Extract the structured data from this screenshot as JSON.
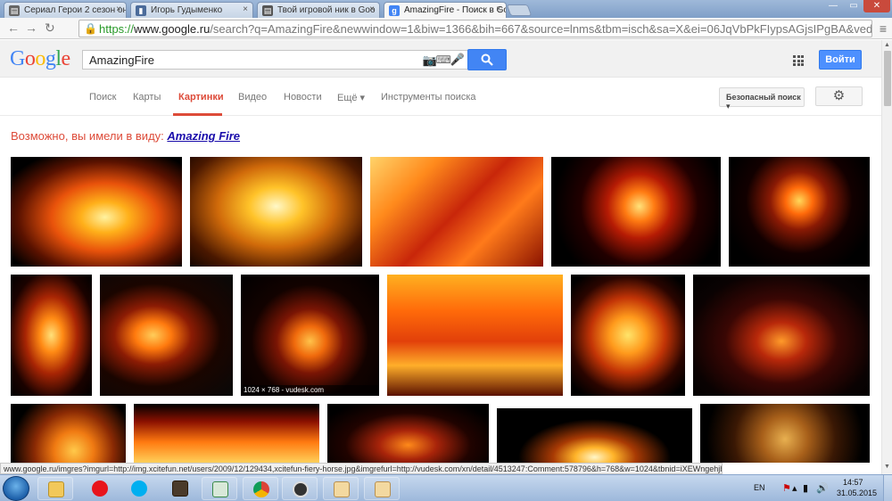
{
  "browser": {
    "tabs": [
      {
        "title": "Сериал Герои 2 сезон он",
        "favicon_color": "#666666",
        "active": false
      },
      {
        "title": "Игорь Гудыменко",
        "favicon_color": "#4b6b9a",
        "active": false
      },
      {
        "title": "Твой игровой ник в Goo",
        "favicon_color": "#555555",
        "active": false
      },
      {
        "title": "AmazingFire - Поиск в Go",
        "favicon_color": "#4285f4",
        "active": true
      }
    ],
    "url": {
      "scheme": "https://",
      "host": "www.google.ru",
      "rest": "/search?q=AmazingFire&newwindow=1&biw=1366&bih=667&source=lnms&tbm=isch&sa=X&ei=06JqVbPkFIypsAGjsIPgBA&ved=0CAcQ_AU"
    }
  },
  "google": {
    "logo_letters": [
      {
        "ch": "G",
        "color": "#4285f4"
      },
      {
        "ch": "o",
        "color": "#ea4335"
      },
      {
        "ch": "o",
        "color": "#fbbc05"
      },
      {
        "ch": "g",
        "color": "#4285f4"
      },
      {
        "ch": "l",
        "color": "#34a853"
      },
      {
        "ch": "e",
        "color": "#ea4335"
      }
    ],
    "query": "AmazingFire",
    "login_label": "Войти",
    "tabs": [
      "Поиск",
      "Карты",
      "Картинки",
      "Видео",
      "Новости",
      "Ещё ▾",
      "Инструменты поиска"
    ],
    "active_tab": "Картинки",
    "safe_search_label": "Безопасный поиск ▾",
    "did_you_mean_prefix": "Возможно, вы имели в виду:",
    "did_you_mean_link": "Amazing Fire",
    "image_caption": "1024 × 768 - vudesk.com",
    "accent_color": "#dd4b39"
  },
  "status_text": "www.google.ru/imgres?imgurl=http://img.xcitefun.net/users/2009/12/129434,xcitefun-fiery-horse.jpg&imgrefurl=http://vudesk.com/xn/detail/4513247:Comment:578796&h=768&w=1024&tbnid=iXEWngehjbIU_M:&zoom=1&docid=LG25oJu7p3yoC...",
  "taskbar": {
    "lang": "EN",
    "time": "14:57",
    "date": "31.05.2015"
  }
}
